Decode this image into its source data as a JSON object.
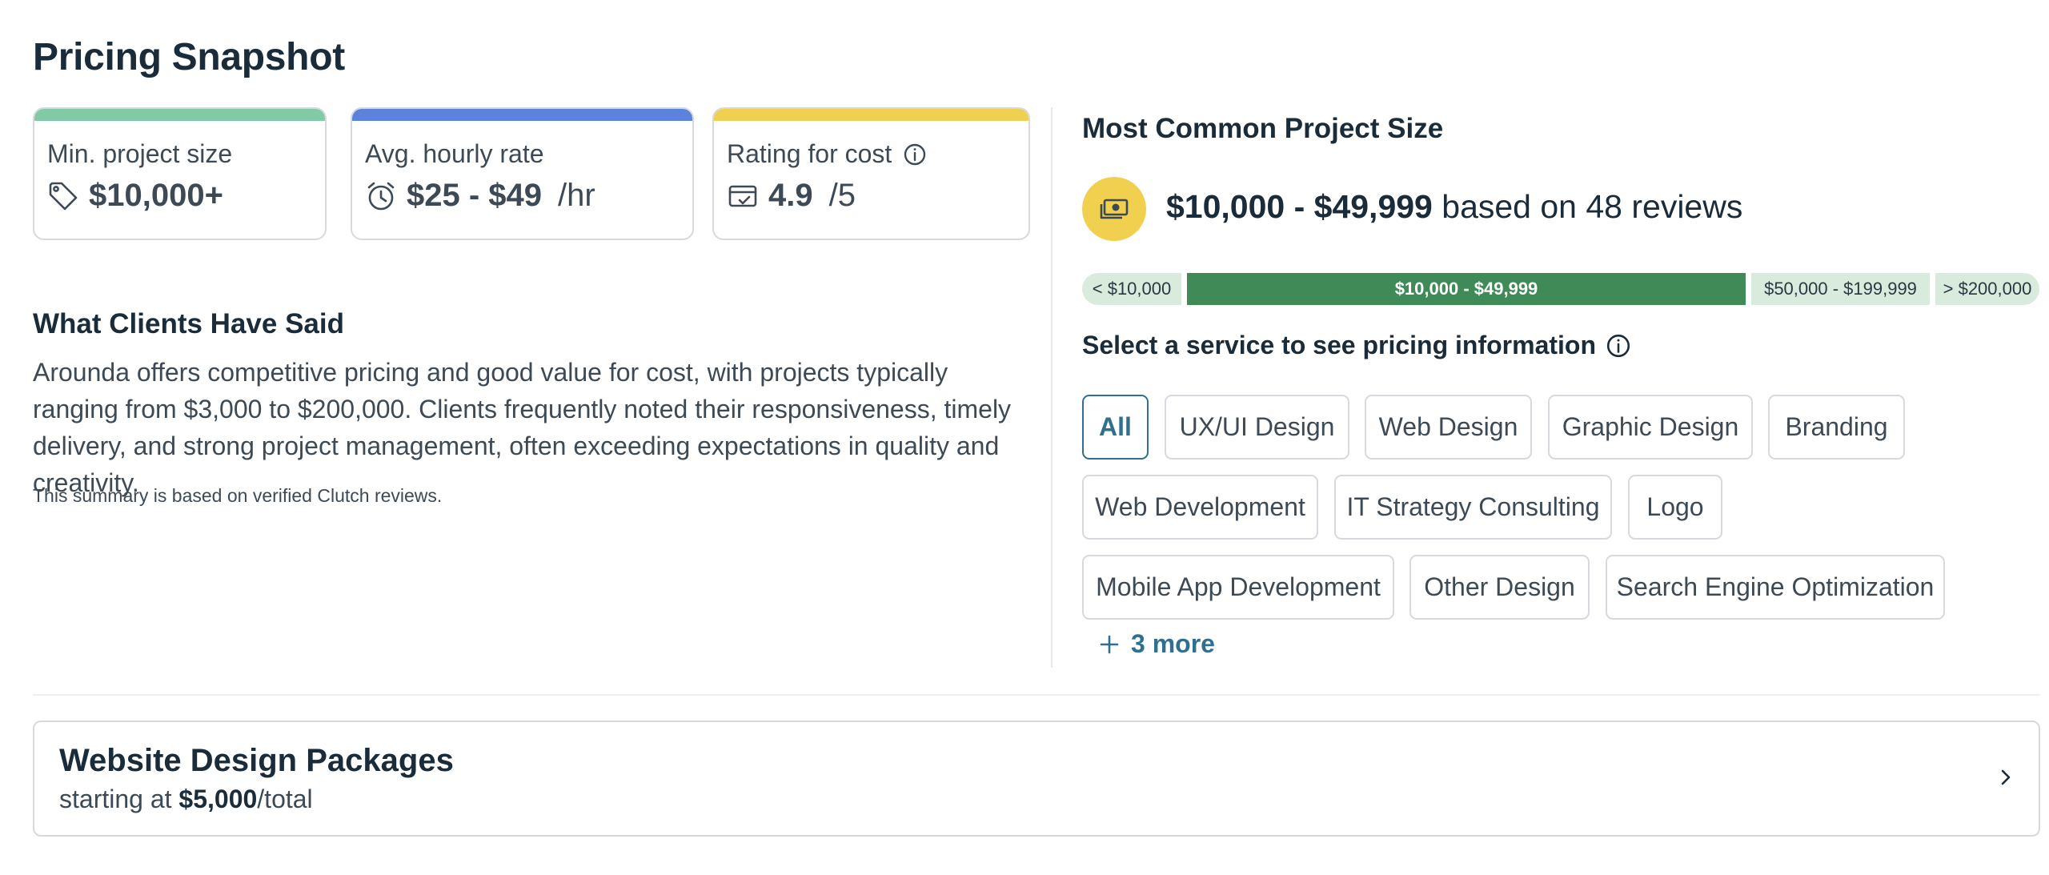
{
  "page_title": "Pricing Snapshot",
  "stats": [
    {
      "label": "Min. project size",
      "value": "$10,000+",
      "suffix": "",
      "icon": "tag-icon",
      "accent": "#82c9a5"
    },
    {
      "label": "Avg. hourly rate",
      "value": "$25 - $49",
      "suffix": "/hr",
      "icon": "alarm-clock-icon",
      "accent": "#5b82dc"
    },
    {
      "label": "Rating for cost",
      "value": "4.9",
      "suffix": "/5",
      "icon": "wallet-check-icon",
      "accent": "#f0d050",
      "info_icon": "info-icon"
    }
  ],
  "clients": {
    "title": "What Clients Have Said",
    "text": "Arounda offers competitive pricing and good value for cost, with projects typically ranging from $3,000 to $200,000. Clients frequently noted their responsiveness, timely delivery, and strong project management, often exceeding expectations in quality and creativity.",
    "note": "This summary is based on verified Clutch reviews."
  },
  "project_size": {
    "title": "Most Common Project Size",
    "range": "$10,000 - $49,999",
    "suffix": "based on 48 reviews",
    "icon": "money-icon",
    "badge_color": "#f2d04f",
    "segments": [
      {
        "label": "< $10,000",
        "active": false
      },
      {
        "label": "$10,000 - $49,999",
        "active": true
      },
      {
        "label": "$50,000 - $199,999",
        "active": false
      },
      {
        "label": "> $200,000",
        "active": false
      }
    ],
    "active_color": "#3f8a57",
    "inactive_color": "#d9ebdc"
  },
  "services": {
    "label": "Select a service to see pricing information",
    "chips": [
      "All",
      "UX/UI Design",
      "Web Design",
      "Graphic Design",
      "Branding",
      "Web Development",
      "IT Strategy Consulting",
      "Logo",
      "Mobile App Development",
      "Other Design",
      "Search Engine Optimization"
    ],
    "selected": "All",
    "more": "3 more"
  },
  "package": {
    "title": "Website Design Packages",
    "sub_prefix": "starting at",
    "price": "$5,000",
    "sub_suffix": "/total"
  }
}
